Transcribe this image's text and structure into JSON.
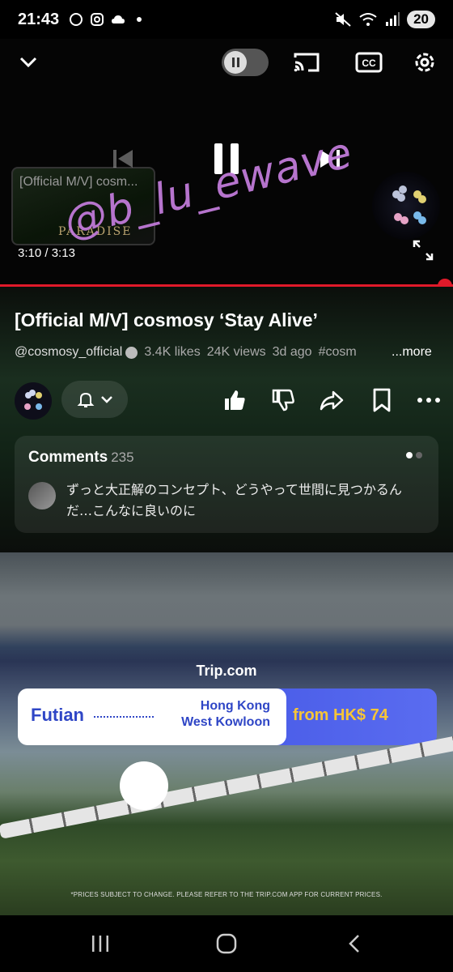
{
  "status_bar": {
    "time": "21:43",
    "battery": "20",
    "network": "5"
  },
  "player": {
    "elapsed": "3:10",
    "duration": "3:13",
    "time_separator": " / ",
    "up_next_title": "[Official M/V] cosm...",
    "up_next_overlay": "PARADISE",
    "progress_fraction": 0.984,
    "icons": [
      "chevron-down-icon",
      "autoplay-toggle-icon",
      "cast-icon",
      "captions-icon",
      "settings-icon",
      "previous-icon",
      "pause-icon",
      "next-icon",
      "fullscreen-icon"
    ]
  },
  "watermark": "@b_lu_ewave",
  "video": {
    "title": "[Official M/V] cosmosy ‘Stay Alive’",
    "channel": "@cosmosy_official",
    "likes": "3.4K likes",
    "views": "24K views",
    "age": "3d ago",
    "hashtag": "#cosm",
    "more": "...more"
  },
  "comments": {
    "label": "Comments",
    "count": "235",
    "top_comment": "ずっと大正解のコンセプト、どうやって世間に見つかるんだ…こんなに良いのに"
  },
  "ad": {
    "brand": "Trip.com",
    "from_city": "Futian",
    "to_city_line1": "Hong Kong",
    "to_city_line2": "West Kowloon",
    "price": "from HK$ 74",
    "disclaimer": "*PRICES SUBJECT TO CHANGE. PLEASE REFER TO THE TRIP.COM APP FOR CURRENT PRICES."
  },
  "colors": {
    "progress": "#e01a2a",
    "watermark": "#c07ad8",
    "ad_blue": "#2f46c6",
    "ad_price_bg": "#4a5de8",
    "ad_price_text": "#f6c537"
  }
}
